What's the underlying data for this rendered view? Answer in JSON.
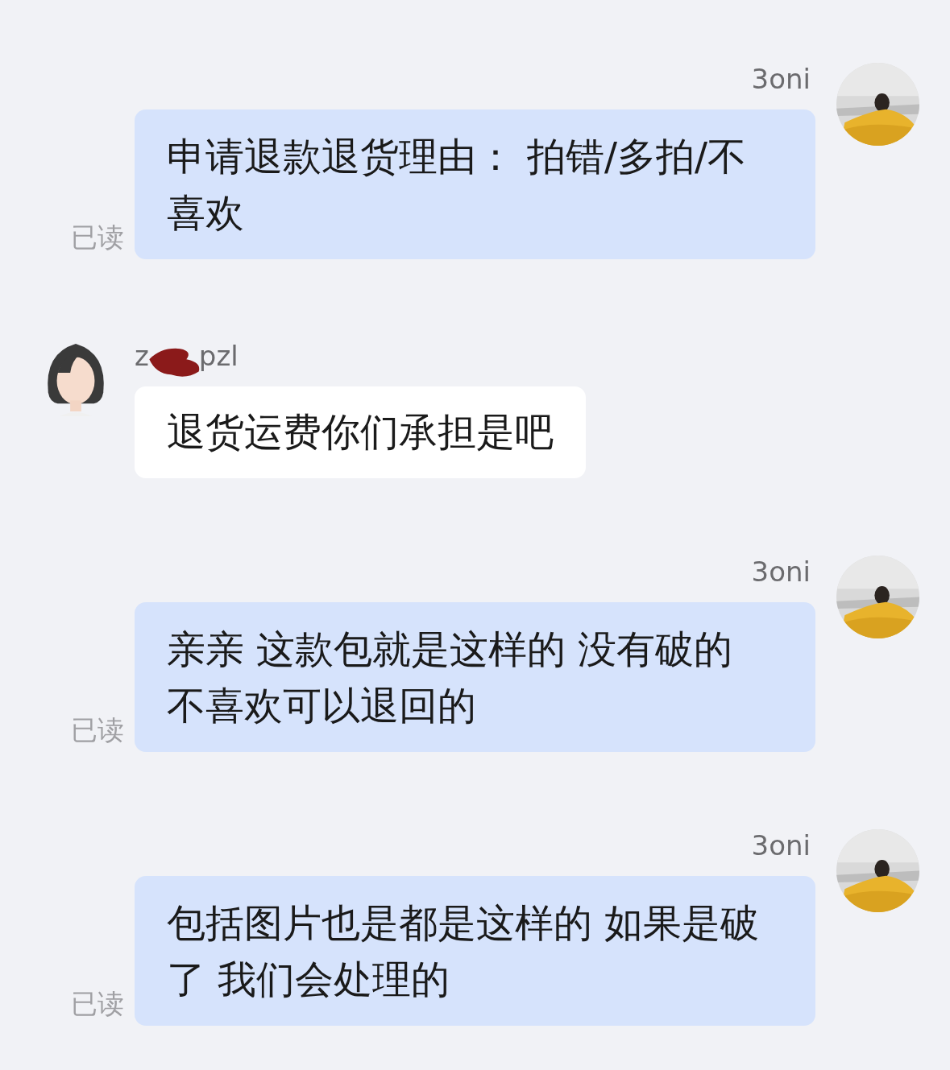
{
  "messages": [
    {
      "kind": "sent",
      "sender": [
        "3oni"
      ],
      "text": "申请退款退货理由： 拍错/多拍/不喜欢",
      "read_label": "已读"
    },
    {
      "kind": "received",
      "sender": [
        "z",
        "pzl"
      ],
      "text": "退货运费你们承担是吧"
    },
    {
      "kind": "sent",
      "sender": [
        "3oni"
      ],
      "text": "亲亲 这款包就是这样的 没有破的不喜欢可以退回的",
      "read_label": "已读"
    },
    {
      "kind": "sent",
      "sender": [
        "3oni"
      ],
      "text": "包括图片也是都是这样的 如果是破了 我们会处理的",
      "read_label": "已读"
    }
  ]
}
